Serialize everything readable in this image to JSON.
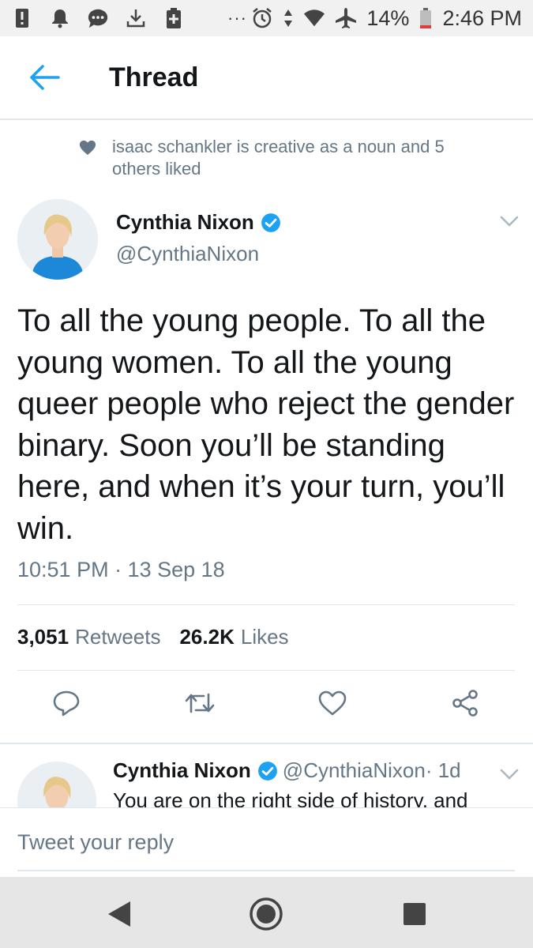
{
  "status_bar": {
    "battery_percent": "14%",
    "time": "2:46 PM",
    "overflow": "···"
  },
  "header": {
    "title": "Thread"
  },
  "social_context": {
    "text": "isaac schankler is creative as a noun and 5 others liked"
  },
  "tweet": {
    "author_name": "Cynthia Nixon",
    "handle": "@CynthiaNixon",
    "text": "To all the young people. To all the young women. To all the young queer people who reject the gender binary. Soon you’ll be standing here, and when it’s your turn, you’ll win.",
    "timestamp": "10:51 PM · 13 Sep 18",
    "retweets_count": "3,051",
    "retweets_label": "Retweets",
    "likes_count": "26.2K",
    "likes_label": "Likes"
  },
  "reply": {
    "author_name": "Cynthia Nixon",
    "handle": "@CynthiaNixon",
    "time": " · 1d",
    "text": "You are on the right side of history, and"
  },
  "composer": {
    "placeholder": "Tweet your reply"
  },
  "colors": {
    "accent": "#1da1f2",
    "text_secondary": "#657786",
    "divider": "#e1e8ed"
  }
}
